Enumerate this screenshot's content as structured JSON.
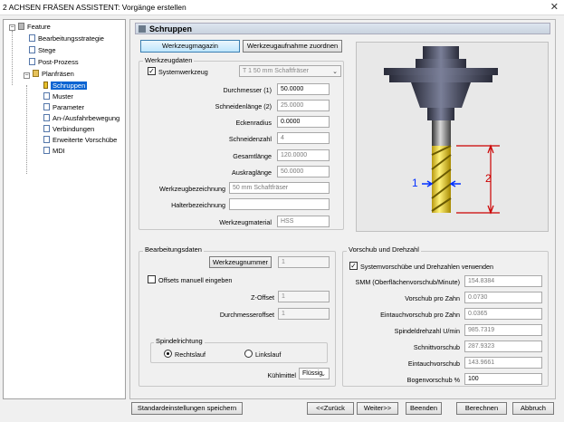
{
  "window": {
    "title": "2 ACHSEN FRÄSEN ASSISTENT: Vorgänge erstellen",
    "close": "✕"
  },
  "tree": {
    "root": "Feature",
    "items": [
      "Bearbeitungsstrategie",
      "Stege",
      "Post-Prozess",
      "Planfräsen"
    ],
    "children": [
      "Schruppen",
      "Muster",
      "Parameter",
      "An-/Ausfahrbewegung",
      "Verbindungen",
      "Erweiterte Vorschübe",
      "MDI"
    ]
  },
  "header": {
    "title": "Schruppen"
  },
  "top_buttons": {
    "magazine": "Werkzeugmagazin",
    "holder": "Werkzeugaufnahme zuordnen"
  },
  "tooldata": {
    "group_title": "Werkzeugdaten",
    "system_tool_label": "Systemwerkzeug",
    "system_tool_value": "T 1 50 mm Schaftfräser",
    "fields": [
      {
        "label": "Durchmesser (1)",
        "value": "50.0000"
      },
      {
        "label": "Schneidenlänge (2)",
        "value": "25.0000"
      },
      {
        "label": "Eckenradius",
        "value": "0.0000"
      },
      {
        "label": "Schneidenzahl",
        "value": "4"
      },
      {
        "label": "Gesamtlänge",
        "value": "120.0000"
      },
      {
        "label": "Auskraglänge",
        "value": "50.0000"
      },
      {
        "label": "Werkzeugbezeichnung",
        "value": "50 mm Schaftfräser"
      },
      {
        "label": "Halterbezeichnung",
        "value": ""
      },
      {
        "label": "Werkzeugmaterial",
        "value": "HSS"
      }
    ]
  },
  "diagram": {
    "label1": "1",
    "label2": "2"
  },
  "machining": {
    "group_title": "Bearbeitungsdaten",
    "toolnum_button": "Werkzeugnummer",
    "toolnum_value": "1",
    "offsets_label": "Offsets manuell eingeben",
    "zoffset_label": "Z-Offset",
    "zoffset_value": "1",
    "diaoffset_label": "Durchmesseroffset",
    "diaoffset_value": "1",
    "spindle_title": "Spindelrichtung",
    "right": "Rechtslauf",
    "left": "Linkslauf",
    "coolant_label": "Kühlmittel",
    "coolant_value": "Flüssig"
  },
  "feeds": {
    "group_title": "Vorschub und Drehzahl",
    "system_label": "Systemvorschübe und Drehzahlen verwenden",
    "fields": [
      {
        "label": "SMM (Oberflächenvorschub/Minute)",
        "value": "154.8384"
      },
      {
        "label": "Vorschub pro Zahn",
        "value": "0.0730"
      },
      {
        "label": "Eintauchvorschub pro Zahn",
        "value": "0.0365"
      },
      {
        "label": "Spindeldrehzahl U/min",
        "value": "985.7319"
      },
      {
        "label": "Schnittvorschub",
        "value": "287.9323"
      },
      {
        "label": "Eintauchvorschub",
        "value": "143.9661"
      },
      {
        "label": "Bogenvorschub %",
        "value": "100"
      }
    ]
  },
  "bottom": {
    "save_defaults": "Standardeinstellungen speichern",
    "back": "<<Zurück",
    "next": "Weiter>>",
    "finish": "Beenden",
    "calc": "Berechnen",
    "cancel": "Abbruch"
  }
}
